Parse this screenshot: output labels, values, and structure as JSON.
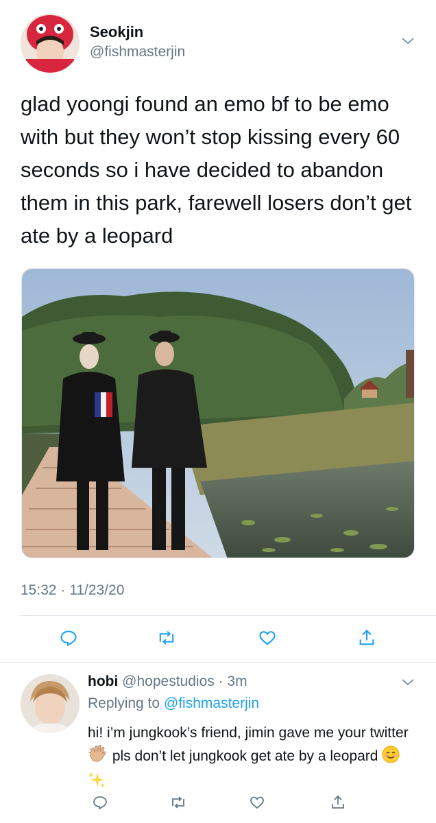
{
  "tweet": {
    "display_name": "Seokjin",
    "handle": "@fishmasterjin",
    "text": "glad yoongi found an emo bf to be emo with but they won’t stop kissing every 60 seconds so i have decided to abandon them in this park, farewell losers don’t get ate by a leopard",
    "timestamp": "15:32 · 11/23/20",
    "photo_icon": "park-photo",
    "actions": [
      "reply-icon",
      "retweet-icon",
      "like-icon",
      "share-icon"
    ]
  },
  "reply": {
    "display_name": "hobi",
    "handle": "@hopestudios",
    "time_sep": " · ",
    "time": "3m",
    "replying_prefix": "Replying to ",
    "replying_to": "@fishmasterjin",
    "text_1": "hi! i’m jungkook’s friend, jimin gave me your twitter ",
    "text_2": " pls don’t let jungkook get ate by a leopard ",
    "emojis": [
      "waving-hand-emoji",
      "smiling-face-emoji",
      "sparkles-emoji"
    ],
    "actions": [
      "reply-icon",
      "retweet-icon",
      "like-icon",
      "share-icon"
    ]
  },
  "colors": {
    "text": "#0f1419",
    "secondary": "#657786",
    "link": "#1da1f2",
    "divider": "#e1e8ed"
  }
}
